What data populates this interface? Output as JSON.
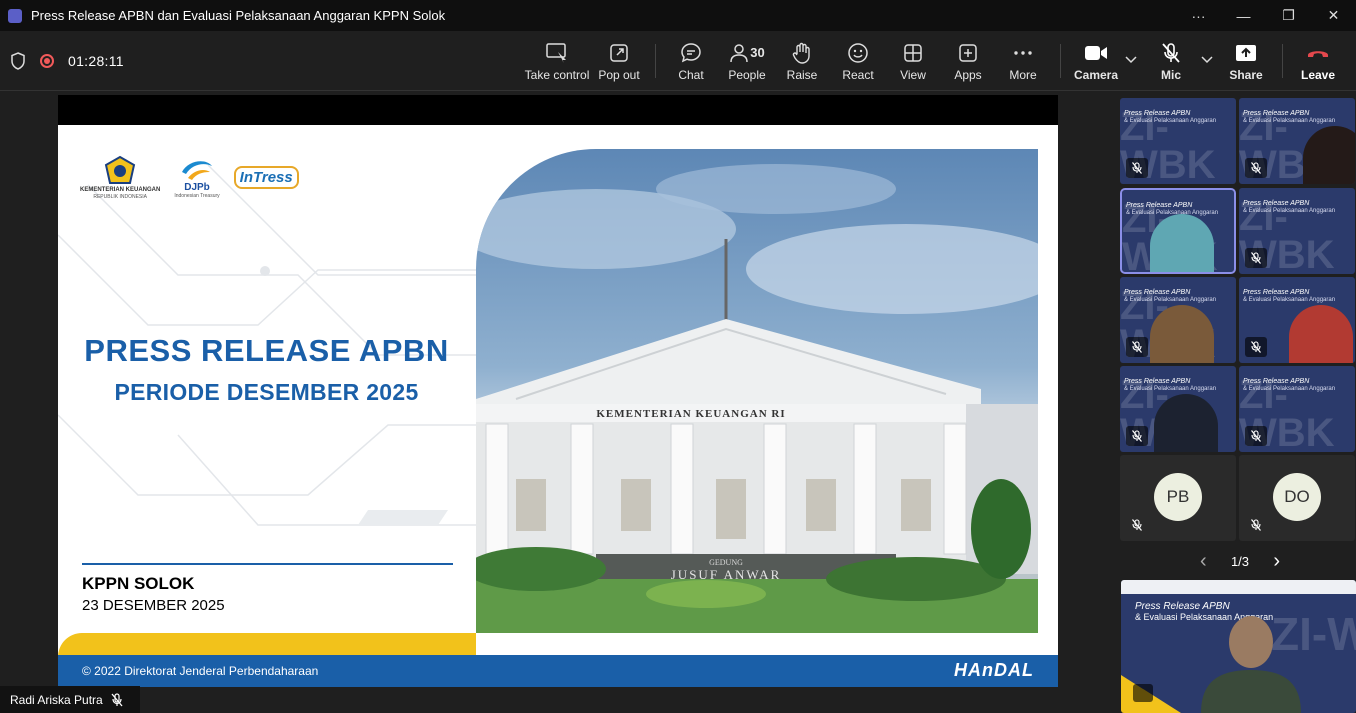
{
  "window": {
    "title": "Press Release APBN dan Evaluasi Pelaksanaan Anggaran KPPN Solok",
    "more": "···",
    "minimize": "—",
    "restore": "❐",
    "close": "✕"
  },
  "meeting": {
    "timer": "01:28:11"
  },
  "toolbar": {
    "take_control": "Take control",
    "pop_out": "Pop out",
    "chat": "Chat",
    "people": "People",
    "people_count": "30",
    "raise": "Raise",
    "react": "React",
    "view": "View",
    "apps": "Apps",
    "more": "More",
    "camera": "Camera",
    "mic": "Mic",
    "share": "Share",
    "leave": "Leave"
  },
  "slide": {
    "logo1_caption": "KEMENTERIAN KEUANGAN",
    "logo1_sub": "REPUBLIK INDONESIA",
    "logo2_caption": "DJPb",
    "logo2_sub": "Indonesian Treasury",
    "logo3_caption": "InTress",
    "title": "PRESS RELEASE APBN",
    "subtitle": "PERIODE DESEMBER 2025",
    "org": "KPPN SOLOK",
    "date": "23 DESEMBER 2025",
    "footer_copyright": "© 2022 Direktorat Jenderal Perbendaharaan",
    "footer_brand": "HAnDAL",
    "building_sign": "KEMENTERIAN KEUANGAN RI",
    "gate_sign1": "GEDUNG",
    "gate_sign2": "JUSUF ANWAR"
  },
  "speaker": {
    "name": "Radi Ariska Putra"
  },
  "gallery": {
    "tile_text1": "Press Release APBN",
    "tile_text2": "& Evaluasi Pelaksanaan Anggaran",
    "tile_watermark": "ZI-WBK",
    "avatar_pb": "PB",
    "avatar_do": "DO",
    "pager": "1/3",
    "prev": "‹",
    "next": "›"
  },
  "colors": {
    "accent": "#1a5fa8",
    "yellow": "#f2c21b",
    "record": "#f25a5a",
    "leave": "#e5484d"
  }
}
